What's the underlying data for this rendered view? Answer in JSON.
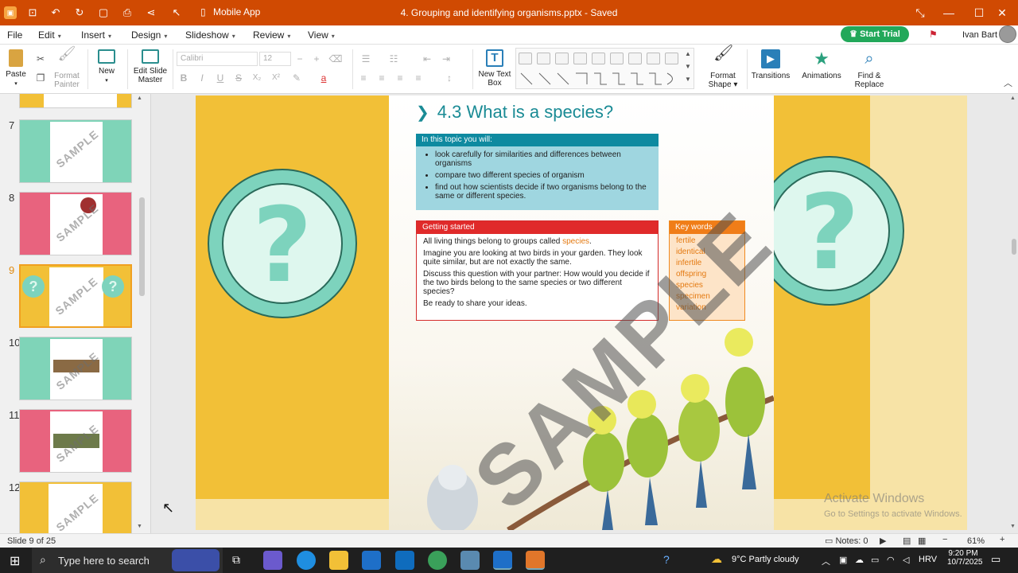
{
  "window": {
    "title": "4. Grouping and identifying organisms.pptx - Saved",
    "mobile_app": "Mobile App",
    "minimize": "—",
    "maximize": "☐",
    "close": "✕",
    "collapse": "⤡"
  },
  "menu": {
    "file": "File",
    "edit": "Edit",
    "insert": "Insert",
    "design": "Design",
    "slideshow": "Slideshow",
    "review": "Review",
    "view": "View",
    "start_trial": "Start Trial",
    "user": "Ivan Bart"
  },
  "ribbon": {
    "paste": "Paste",
    "format_painter": "Format Painter",
    "new": "New",
    "edit_slide_master": "Edit Slide Master",
    "font_name": "Calibri",
    "font_size": "12",
    "new_text_box": "New Text Box",
    "format_shape": "Format Shape",
    "transitions": "Transitions",
    "animations": "Animations",
    "find_replace": "Find & Replace",
    "bold": "B",
    "italic": "I",
    "underline": "U",
    "strike": "S",
    "subscript": "X₂",
    "superscript": "X²"
  },
  "thumbnails": [
    {
      "num": "7",
      "color": "#7fd4b8"
    },
    {
      "num": "8",
      "color": "#e8637e"
    },
    {
      "num": "9",
      "color": "#f2c037"
    },
    {
      "num": "10",
      "color": "#7fd4b8"
    },
    {
      "num": "11",
      "color": "#e8637e"
    },
    {
      "num": "12",
      "color": "#f2c037"
    }
  ],
  "slide": {
    "heading_chevron": "❯",
    "heading": "4.3  What is a species?",
    "topic_title": "In this topic you will:",
    "topic_items": [
      "look carefully for similarities and differences between organisms",
      "compare two different species of organism",
      "find out how scientists decide if two organisms belong to the same or different species."
    ],
    "getting_started_title": "Getting started",
    "gs_p1_pre": "All living things belong to groups called ",
    "gs_p1_kw": "species",
    "gs_p1_post": ".",
    "gs_p2": "Imagine you are looking at two birds in your garden. They look quite similar, but are not exactly the same.",
    "gs_p3": "Discuss this question with your partner: How would you decide if the two birds belong to the same species or two different species?",
    "gs_p4": "Be ready to share your ideas.",
    "key_words_title": "Key words",
    "key_words": [
      "fertile",
      "identical",
      "infertile",
      "offspring",
      "species",
      "specimen",
      "variation"
    ],
    "watermark": "SAMPLE",
    "question_mark": "?"
  },
  "activate": {
    "line1": "Activate Windows",
    "line2": "Go to Settings to activate Windows."
  },
  "status": {
    "slide_of": "Slide 9 of 25",
    "notes": "Notes: 0",
    "zoom": "61%"
  },
  "taskbar": {
    "search_placeholder": "Type here to search",
    "weather": "9°C  Partly cloudy",
    "lang": "HRV",
    "time": "9:20 PM",
    "date": "10/7/2025"
  }
}
